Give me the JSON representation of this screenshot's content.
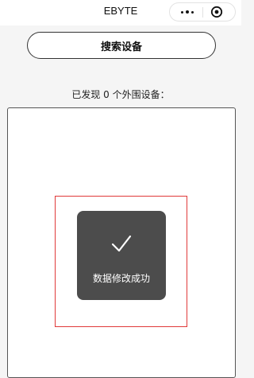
{
  "nav": {
    "title": "EBYTE",
    "more_icon": "more-dots-icon",
    "close_icon": "target-circle-icon"
  },
  "search_button": {
    "label": "搜索设备"
  },
  "status": {
    "found_text": "已发现 0 个外围设备："
  },
  "toast": {
    "icon": "checkmark-icon",
    "message": "数据修改成功"
  },
  "colors": {
    "background": "#f5f5f5",
    "toast_bg": "#4c4c4c",
    "highlight_border": "#e03a3a"
  }
}
